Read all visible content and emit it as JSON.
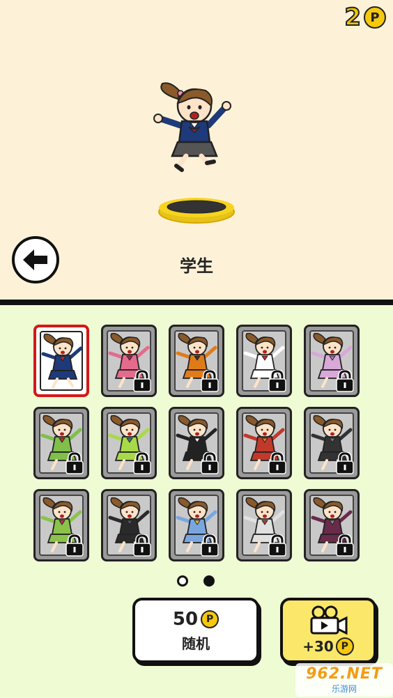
{
  "coins": {
    "count": "2",
    "symbol": "P"
  },
  "selected_character": {
    "name": "学生"
  },
  "grid": {
    "cards": [
      {
        "id": "student",
        "locked": false,
        "selected": true,
        "outfit": "#1e3a7a",
        "accent": "#d62828"
      },
      {
        "id": "pink-dress",
        "locked": true,
        "outfit": "#e56b8c",
        "accent": "#c2185b"
      },
      {
        "id": "orange-kimono",
        "locked": true,
        "outfit": "#e07b1a",
        "accent": "#333"
      },
      {
        "id": "shrine-maiden",
        "locked": true,
        "outfit": "#ffffff",
        "accent": "#d62828"
      },
      {
        "id": "bunny-costume",
        "locked": true,
        "outfit": "#d8a8d8",
        "accent": "#b07ab0"
      },
      {
        "id": "fairy",
        "locked": true,
        "outfit": "#7fbf4a",
        "accent": "#d62828"
      },
      {
        "id": "green-apron",
        "locked": true,
        "outfit": "#a8d94a",
        "accent": "#3a7a8a"
      },
      {
        "id": "maid",
        "locked": true,
        "outfit": "#222222",
        "accent": "#ffffff"
      },
      {
        "id": "basketball",
        "locked": true,
        "outfit": "#c0392b",
        "accent": "#e67e22"
      },
      {
        "id": "black-outfit",
        "locked": true,
        "outfit": "#333333",
        "accent": "#777"
      },
      {
        "id": "hula",
        "locked": true,
        "outfit": "#8bc34a",
        "accent": "#e91e63"
      },
      {
        "id": "witch",
        "locked": true,
        "outfit": "#2a2a2a",
        "accent": "#555"
      },
      {
        "id": "cheerleader",
        "locked": true,
        "outfit": "#7aa6e0",
        "accent": "#f1c40f"
      },
      {
        "id": "red-kimono",
        "locked": true,
        "outfit": "#e0e0e0",
        "accent": "#c0392b"
      },
      {
        "id": "ninja",
        "locked": true,
        "outfit": "#6a2a4a",
        "accent": "#888"
      }
    ]
  },
  "pager": {
    "pages": 2,
    "active": 1
  },
  "random_button": {
    "price": "50",
    "label": "随机"
  },
  "video_button": {
    "reward": "+30"
  },
  "watermark": {
    "line1": "962.NET",
    "line2": "乐游网"
  },
  "colors": {
    "top_bg": "#fdf2d8",
    "bottom_bg": "#eefbd3",
    "coin": "#f6c90e",
    "selected_border": "#d41717",
    "video_bg": "#fbe76a"
  }
}
